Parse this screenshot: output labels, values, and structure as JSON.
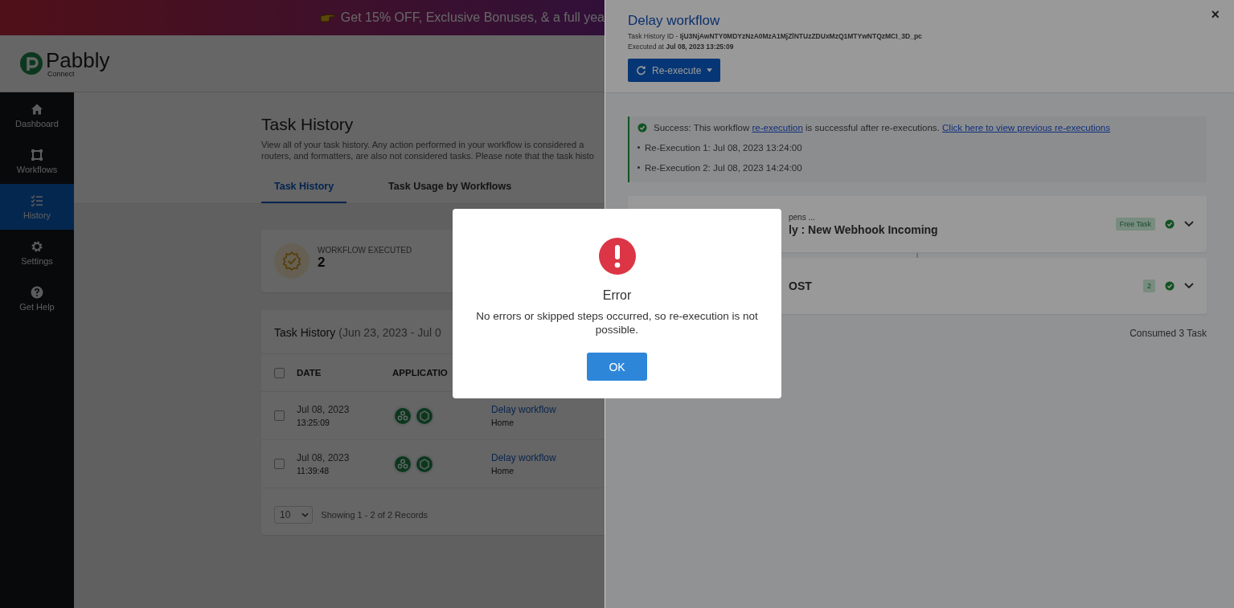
{
  "banner": {
    "text": "Get 15% OFF, Exclusive Bonuses, & a full yea"
  },
  "logo": {
    "name": "Pabbly",
    "sub": "Connect"
  },
  "sidebar": {
    "items": [
      {
        "label": "Dashboard",
        "selected": false
      },
      {
        "label": "Workflows",
        "selected": false
      },
      {
        "label": "History",
        "selected": true
      },
      {
        "label": "Settings",
        "selected": false
      },
      {
        "label": "Get Help",
        "selected": false
      }
    ]
  },
  "page": {
    "title": "Task History",
    "description": [
      "View all of your task history. Any action performed in your workflow is considered a",
      "routers, and formatters, are also not considered tasks. Please note that the task histo"
    ],
    "tabs": [
      {
        "label": "Task History",
        "selected": true
      },
      {
        "label": "Task Usage by Workflows",
        "selected": false
      }
    ]
  },
  "stat": {
    "label": "WORKFLOW EXECUTED",
    "value": "2"
  },
  "task_card": {
    "title": "Task History",
    "range": "(Jun 23, 2023 - Jul 0",
    "header_checked": false,
    "columns": [
      "DATE",
      "APPLICATIO"
    ],
    "rows": [
      {
        "checked": false,
        "date": "Jul 08, 2023",
        "time": "13:25:09",
        "workflow": "Delay workflow",
        "folder": "Home"
      },
      {
        "checked": false,
        "date": "Jul 08, 2023",
        "time": "11:39:48",
        "workflow": "Delay workflow",
        "folder": "Home"
      }
    ],
    "page_size": "10",
    "summary": "Showing 1 - 2 of 2 Records"
  },
  "panel": {
    "title": "Delay workflow",
    "id_label": "Task History ID - ",
    "id": "IjU3NjAwNTY0MDYzNzA0MzA1MjZlNTUzZDUxMzQ1MTYwNTQzMCI_3D_pc",
    "executed_label": "Executed at ",
    "executed": "Jul 08, 2023 13:25:09",
    "button": "Re-execute",
    "close": "×",
    "alert": {
      "before": "Success: This workflow ",
      "link": "re-execution",
      "middle": " is successful after re-executions. ",
      "link2": "Click here to view previous re-executions",
      "executions": [
        "Re-Execution 1: Jul 08, 2023 13:24:00",
        "Re-Execution 2: Jul 08, 2023 14:24:00"
      ]
    },
    "steps": [
      {
        "caption": "pens ...",
        "title": "ly : New Webhook Incoming",
        "badge": "Free Task",
        "expanded": false
      },
      {
        "title": "OST",
        "badge": "2",
        "expanded": false
      }
    ],
    "consumed": "Consumed 3 Task"
  },
  "modal": {
    "kind": "error",
    "title": "Error",
    "message": "No errors or skipped steps occurred, so re-execution is not possible.",
    "button": "OK"
  }
}
